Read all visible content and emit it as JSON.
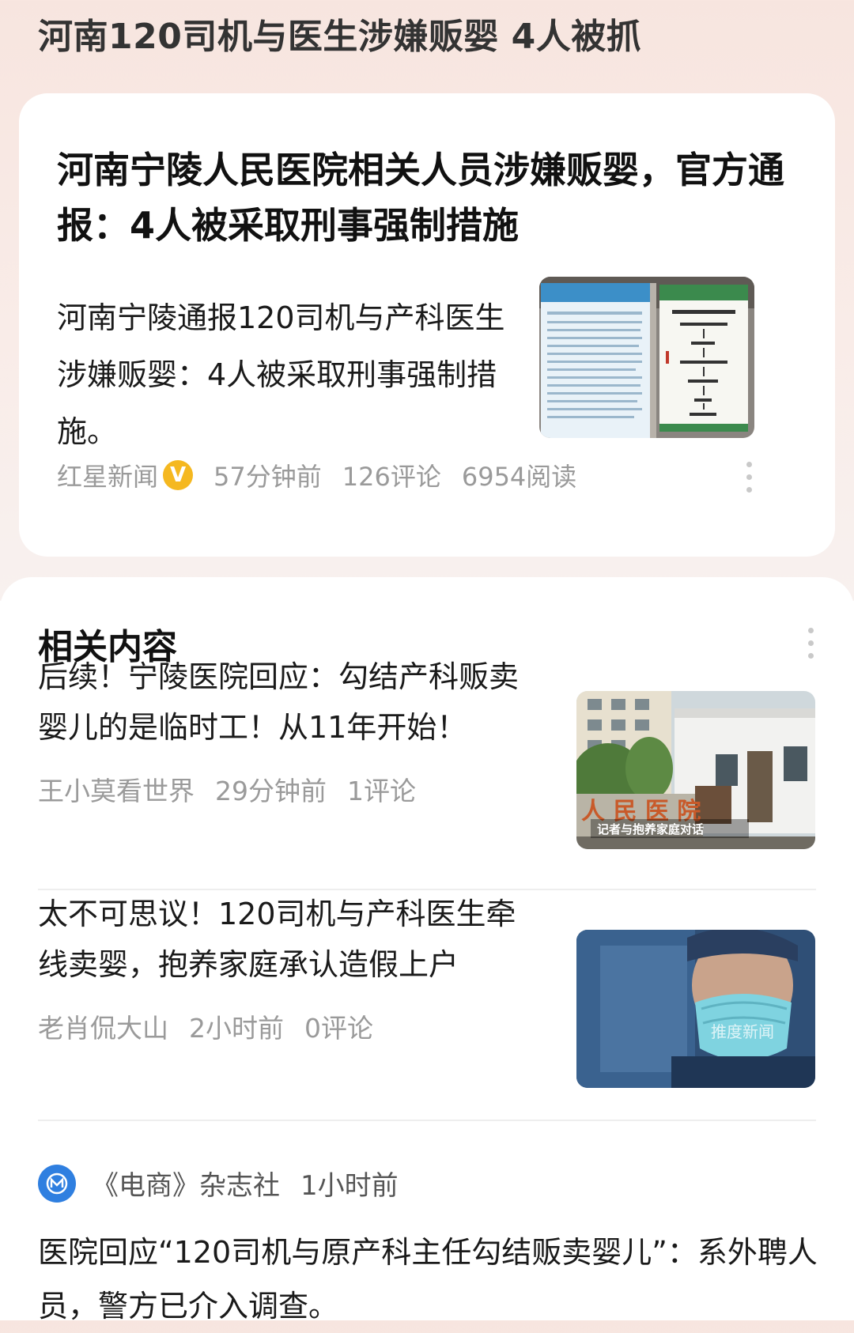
{
  "header": {
    "title": "河南120司机与医生涉嫌贩婴 4人被抓"
  },
  "news_card": {
    "headline": "河南宁陵人民医院相关人员涉嫌贩婴，官方通报：4人被采取刑事强制措施",
    "summary": "河南宁陵通报120司机与产科医生涉嫌贩婴：4人被采取刑事强制措施。",
    "source": "红星新闻",
    "verified_badge": "V",
    "time": "57分钟前",
    "comments": "126评论",
    "reads": "6954阅读",
    "thumbnail_icon": "hospital-notice-board-photo"
  },
  "related": {
    "section_title": "相关内容",
    "items": [
      {
        "title": "后续！宁陵医院回应：勾结产科贩卖婴儿的是临时工！从11年开始！",
        "author": "王小莫看世界",
        "time": "29分钟前",
        "comments": "1评论",
        "thumb_caption": "记者与抱养家庭对话",
        "thumb_sign": "人 民 医 院"
      },
      {
        "title": "太不可思议！120司机与产科医生牵线卖婴，抱养家庭承认造假上户",
        "author": "老肖侃大山",
        "time": "2小时前",
        "comments": "0评论",
        "thumb_watermark": "推度新闻"
      }
    ],
    "last": {
      "source": "《电商》杂志社",
      "time": "1小时前",
      "title": "医院回应“120司机与原产科主任勾结贩卖婴儿”：系外聘人员，警方已介入调查。"
    }
  },
  "colors": {
    "verified": "#f5b820",
    "source_logo": "#2f7fe0",
    "meta_text": "#9a9a9a"
  }
}
